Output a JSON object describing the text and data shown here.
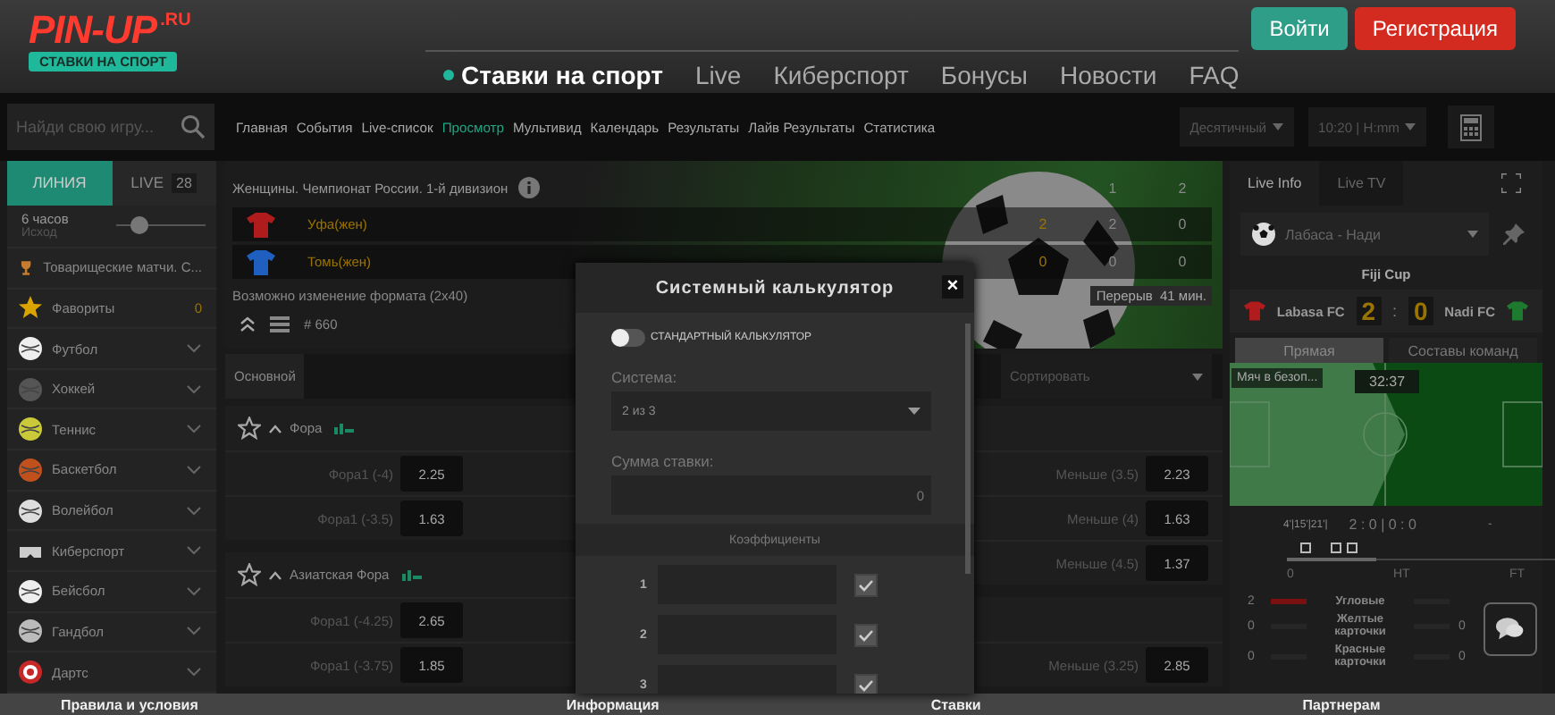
{
  "header": {
    "logo": {
      "name": "PIN-UP",
      "domain": ".RU",
      "tagline": "СТАВКИ НА СПОРТ"
    },
    "nav": [
      {
        "label": "Ставки на спорт",
        "selected": true
      },
      {
        "label": "Live",
        "selected": false
      },
      {
        "label": "Киберспорт",
        "selected": false
      },
      {
        "label": "Бонусы",
        "selected": false
      },
      {
        "label": "Новости",
        "selected": false
      },
      {
        "label": "FAQ",
        "selected": false
      }
    ],
    "buttons": [
      {
        "label": "Войти",
        "kind": "login"
      },
      {
        "label": "Регистрация",
        "kind": "register"
      }
    ]
  },
  "toolbar": {
    "search": {
      "placeholder": "Найди свою игру..."
    },
    "links": [
      {
        "label": "Главная",
        "selected": false
      },
      {
        "label": "События",
        "selected": false
      },
      {
        "label": "Live-список",
        "selected": false
      },
      {
        "label": "Просмотр",
        "selected": true
      },
      {
        "label": "Мультивид",
        "selected": false
      },
      {
        "label": "Календарь",
        "selected": false
      },
      {
        "label": "Результаты",
        "selected": false
      },
      {
        "label": "Лайв Результаты",
        "selected": false
      },
      {
        "label": "Статистика",
        "selected": false
      }
    ],
    "odds_format": "Десятичный",
    "time_format": "10:20 | H:mm"
  },
  "sidebar": {
    "tabs": [
      {
        "label": "ЛИНИЯ",
        "selected": true
      },
      {
        "label": "LIVE",
        "count": "28",
        "selected": false
      }
    ],
    "period": {
      "label": "6 часов",
      "sub": "Исход",
      "level": 0.25
    },
    "items": [
      {
        "label": "Товарищеские матчи. С...",
        "kind": "tournament"
      },
      {
        "label": "Фавориты",
        "count": "0",
        "kind": "favorites"
      },
      {
        "label": "Футбол",
        "kind": "sport"
      },
      {
        "label": "Хоккей",
        "kind": "sport"
      },
      {
        "label": "Теннис",
        "kind": "sport"
      },
      {
        "label": "Баскетбол",
        "kind": "sport"
      },
      {
        "label": "Волейбол",
        "kind": "sport"
      },
      {
        "label": "Киберспорт",
        "kind": "sport"
      },
      {
        "label": "Бейсбол",
        "kind": "sport"
      },
      {
        "label": "Гандбол",
        "kind": "sport"
      },
      {
        "label": "Дартс",
        "kind": "sport"
      }
    ]
  },
  "match": {
    "league": "Женщины. Чемпионат России. 1-й дивизион",
    "columns": [
      "1",
      "2"
    ],
    "teams": [
      {
        "name": "Уфа(жен)",
        "color": "#b01c1c",
        "live": "2",
        "scores": [
          "2",
          "0"
        ]
      },
      {
        "name": "Томь(жен)",
        "color": "#1f5fc0",
        "live": "0",
        "scores": [
          "0",
          "0"
        ]
      }
    ],
    "note": "Возможно изменение формата (2x40)",
    "number": "# 660",
    "status": "Перерыв",
    "minute": "41 мин."
  },
  "market_tabs": [
    {
      "label": "Основной",
      "selected": true
    }
  ],
  "sort": {
    "placeholder": "Сортировать"
  },
  "markets": [
    [
      {
        "title": "Фора",
        "rows": [
          {
            "label": "Фора1 (-4)",
            "odd": "2.25"
          },
          {
            "label": "Фора1 (-3.5)",
            "odd": "1.63"
          }
        ]
      },
      {
        "title": "Азиатская Фора",
        "rows": [
          {
            "label": "Фора1 (-4.25)",
            "odd": "2.65"
          },
          {
            "label": "Фора1 (-3.75)",
            "odd": "1.85"
          }
        ]
      }
    ],
    [
      {
        "rows": [
          {
            "label": "Меньше (3.5)",
            "odd": "2.23"
          },
          {
            "label": "Меньше (4)",
            "odd": "1.63"
          },
          {
            "label": "Меньше (4.5)",
            "odd": "1.37"
          }
        ]
      },
      {
        "rows": [
          {
            "label": "Меньше (3.25)",
            "odd": "2.85"
          }
        ]
      }
    ]
  ],
  "live": {
    "tabs": [
      {
        "label": "Live Info",
        "selected": true
      },
      {
        "label": "Live TV",
        "selected": false
      }
    ],
    "event_select": "Лабаса - Нади",
    "tournament": "Fiji Cup",
    "home": {
      "name": "Labasa FC",
      "score": "2",
      "color": "#b01c1c"
    },
    "away": {
      "name": "Nadi FC",
      "score": "0",
      "color": "#1e7a2e"
    },
    "separator": ":",
    "view_tabs": [
      {
        "label": "Прямая",
        "selected": true
      },
      {
        "label": "Составы команд",
        "selected": false
      }
    ],
    "pitch": {
      "event": "Мяч в безоп...",
      "clock": "32:37"
    },
    "goal_minutes": "4'|15'|21'|",
    "period_scores": "2 : 0 | 0 : 0",
    "extra": "-",
    "timeline_labels": [
      "0",
      "HT",
      "FT"
    ],
    "stats": [
      {
        "home": "2",
        "label": "Угловые"
      },
      {
        "home": "0",
        "label": "Желтые карточки",
        "away": "0"
      },
      {
        "home": "0",
        "label": "Красные карточки",
        "away": "0"
      }
    ]
  },
  "calculator": {
    "title": "Системный калькулятор",
    "close": "×",
    "standard": {
      "label": "СТАНДАРТНЫЙ КАЛЬКУЛЯТОР",
      "on": false
    },
    "system": {
      "label": "Система:",
      "value": "2 из 3"
    },
    "stake": {
      "label": "Сумма ставки:",
      "value": "0"
    },
    "odds_title": "Коэффициенты",
    "odds": [
      {
        "number": "1",
        "checked": true
      },
      {
        "number": "2",
        "checked": true
      },
      {
        "number": "3",
        "checked": true
      }
    ]
  },
  "footer": [
    "Правила и условия",
    "Информация",
    "Ставки",
    "Партнерам"
  ]
}
